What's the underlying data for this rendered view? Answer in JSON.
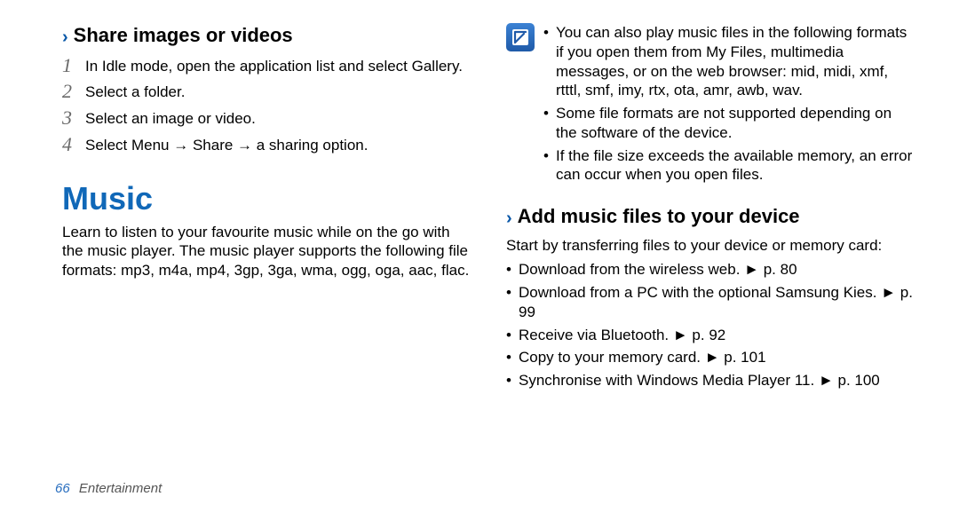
{
  "left": {
    "share_heading": "Share images or videos",
    "steps": [
      "In Idle mode, open the application list and select Gallery.",
      "Select a folder.",
      "Select an image or video.",
      "Select Menu → Share → a sharing option."
    ],
    "music_heading": "Music",
    "music_para": "Learn to listen to your favourite music while on the go with the music player. The music player supports the following file formats: mp3, m4a, mp4, 3gp, 3ga, wma, ogg, oga, aac, flac."
  },
  "right": {
    "note_bullets": [
      "You can also play music files in the following formats if you open them from My Files, multimedia messages, or on the web browser: mid, midi, xmf, rtttl, smf, imy, rtx, ota, amr, awb, wav.",
      "Some file formats are not supported depending on the software of the device.",
      "If the file size exceeds the available memory, an error can occur when you open files."
    ],
    "add_heading": "Add music files to your device",
    "add_intro": "Start by transferring files to your device or memory card:",
    "add_bullets": [
      "Download from the wireless web. ► p. 80",
      "Download from a PC with the optional Samsung Kies. ► p. 99",
      "Receive via Bluetooth. ► p. 92",
      "Copy to your memory card. ► p. 101",
      "Synchronise with Windows Media Player 11. ► p. 100"
    ]
  },
  "footer": {
    "page": "66",
    "section": "Entertainment"
  }
}
